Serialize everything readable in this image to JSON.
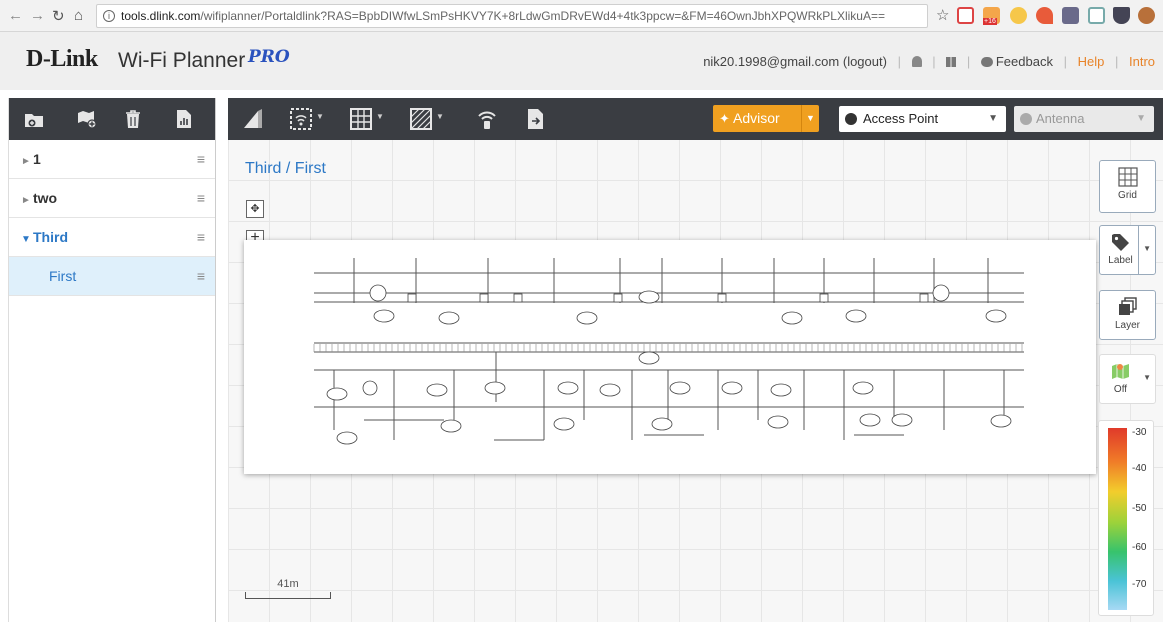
{
  "browser": {
    "url_host": "tools.dlink.com",
    "url_rest": "/wifiplanner/Portaldlink?RAS=BpbDIWfwLSmPsHKVY7K+8rLdwGmDRvEWd4+4tk3ppcw=&FM=46OwnJbhXPQWRkPLXlikuA==",
    "badge_count": "+16"
  },
  "header": {
    "logo": "D-Link",
    "product": "Wi-Fi Planner",
    "pro": "PRO",
    "user_email": "nik20.1998@gmail.com",
    "logout_label": "(logout)",
    "feedback_label": "Feedback",
    "help_label": "Help",
    "intro_label": "Intro"
  },
  "sidebar": {
    "tools": [
      "new-folder-icon",
      "add-map-icon",
      "trash-icon",
      "report-icon"
    ],
    "items": [
      {
        "label": "1"
      },
      {
        "label": "two"
      },
      {
        "label": "Third"
      },
      {
        "label": "First"
      }
    ]
  },
  "toolbar": {
    "advisor_label": "Advisor",
    "access_point_label": "Access Point",
    "antenna_label": "Antenna"
  },
  "main": {
    "breadcrumb": "Third / First",
    "scale_label": "41m"
  },
  "right_panel": {
    "grid_label": "Grid",
    "label_label": "Label",
    "layer_label": "Layer",
    "heatmap_label": "Off"
  },
  "legend": {
    "ticks": [
      "-30",
      "-40",
      "-50",
      "-60",
      "-70"
    ],
    "colors": {
      "strong": "#e03a2a",
      "mid": "#f2cd2c",
      "good": "#37c36c",
      "weak": "#a7d9f4"
    }
  },
  "colors": {
    "toolbar_bg": "#3a3d42",
    "accent_blue": "#2c78c6",
    "advisor_orange": "#f0a020",
    "link_orange": "#e8842a"
  }
}
